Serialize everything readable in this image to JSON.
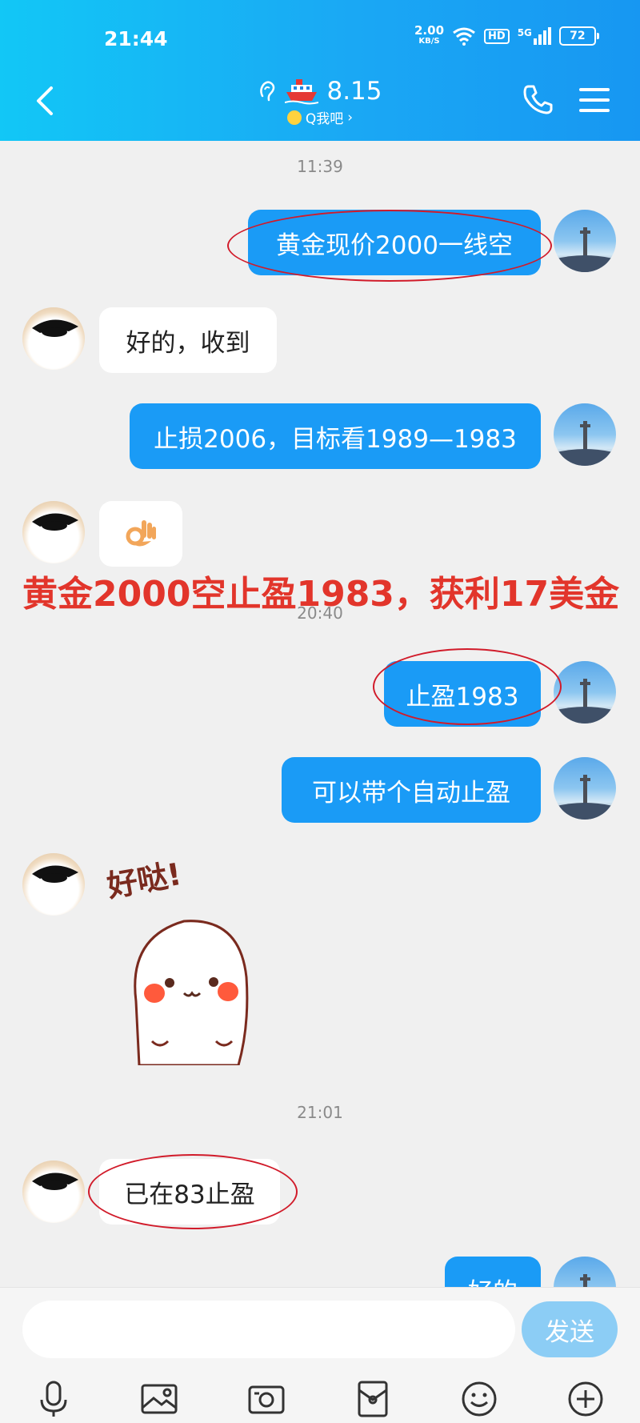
{
  "status_bar": {
    "time": "21:44",
    "net_speed": "2.00",
    "net_unit": "KB/S",
    "hd": "HD",
    "signal": "5G",
    "battery": "72"
  },
  "header": {
    "title": "8.15",
    "subtitle": "Q我吧",
    "subtitle_arrow": "›"
  },
  "messages": [
    {
      "kind": "timestamp",
      "text": "11:39"
    },
    {
      "kind": "out",
      "text": "黄金现价2000一线空"
    },
    {
      "kind": "in",
      "text": "好的，收到"
    },
    {
      "kind": "out",
      "text": "止损2006，目标看1989—1983"
    },
    {
      "kind": "in",
      "emoji": "ok-hand"
    },
    {
      "kind": "timestamp",
      "text": "20:40"
    },
    {
      "kind": "out",
      "text": "止盈1983"
    },
    {
      "kind": "out",
      "text": "可以带个自动止盈"
    },
    {
      "kind": "in",
      "sticker": "cartoon-character",
      "sticker_text": "好哒!"
    },
    {
      "kind": "timestamp",
      "text": "21:01"
    },
    {
      "kind": "in",
      "text": "已在83止盈"
    },
    {
      "kind": "out",
      "text": "好的"
    }
  ],
  "annotation": {
    "text": "黄金2000空止盈1983，获利17美金",
    "color": "#e2352b"
  },
  "input_bar": {
    "placeholder": "",
    "send_label": "发送"
  },
  "toolbar_icons": [
    "microphone-icon",
    "image-icon",
    "camera-icon",
    "red-packet-icon",
    "emoji-icon",
    "plus-icon"
  ],
  "colors": {
    "header": "#1aa8f4",
    "out_bubble": "#1a9bf6",
    "in_bubble": "#ffffff",
    "annotation_ellipse": "#d11b2a"
  }
}
